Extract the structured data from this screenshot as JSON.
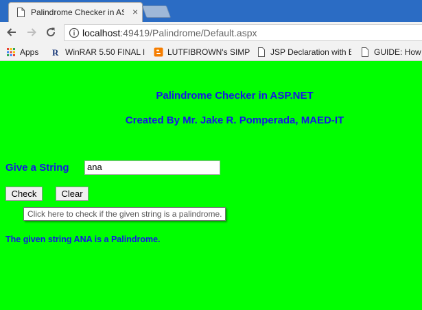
{
  "browser": {
    "tab_title": "Palindrome Checker in ASP.NET",
    "tab_close": "×",
    "url_host": "localhost",
    "url_path": ":49419/Palindrome/Default.aspx",
    "colors": {
      "tabstrip": "#2b6cc4",
      "toolbar": "#f2f2f2"
    }
  },
  "bookmarks": [
    {
      "label": "Apps",
      "icon": "apps-grid-icon"
    },
    {
      "label": "WinRAR 5.50 FINAL I",
      "icon": "winrar-icon"
    },
    {
      "label": "LUTFIBROWN's SIMP",
      "icon": "blogger-icon"
    },
    {
      "label": "JSP Declaration with E",
      "icon": "page-icon"
    },
    {
      "label": "GUIDE: How",
      "icon": "page-icon"
    }
  ],
  "page": {
    "background": "#00ff00",
    "title": "Palindrome Checker in ASP.NET",
    "author": "Created By Mr. Jake R. Pomperada, MAED-IT",
    "input_label": "Give a String",
    "input_value": "ana",
    "check_label": "Check",
    "clear_label": "Clear",
    "tooltip": "Click here to check if the given string is a palindrome.",
    "result": "The given string ANA is a Palindrome.",
    "text_color": "#1515e6"
  }
}
